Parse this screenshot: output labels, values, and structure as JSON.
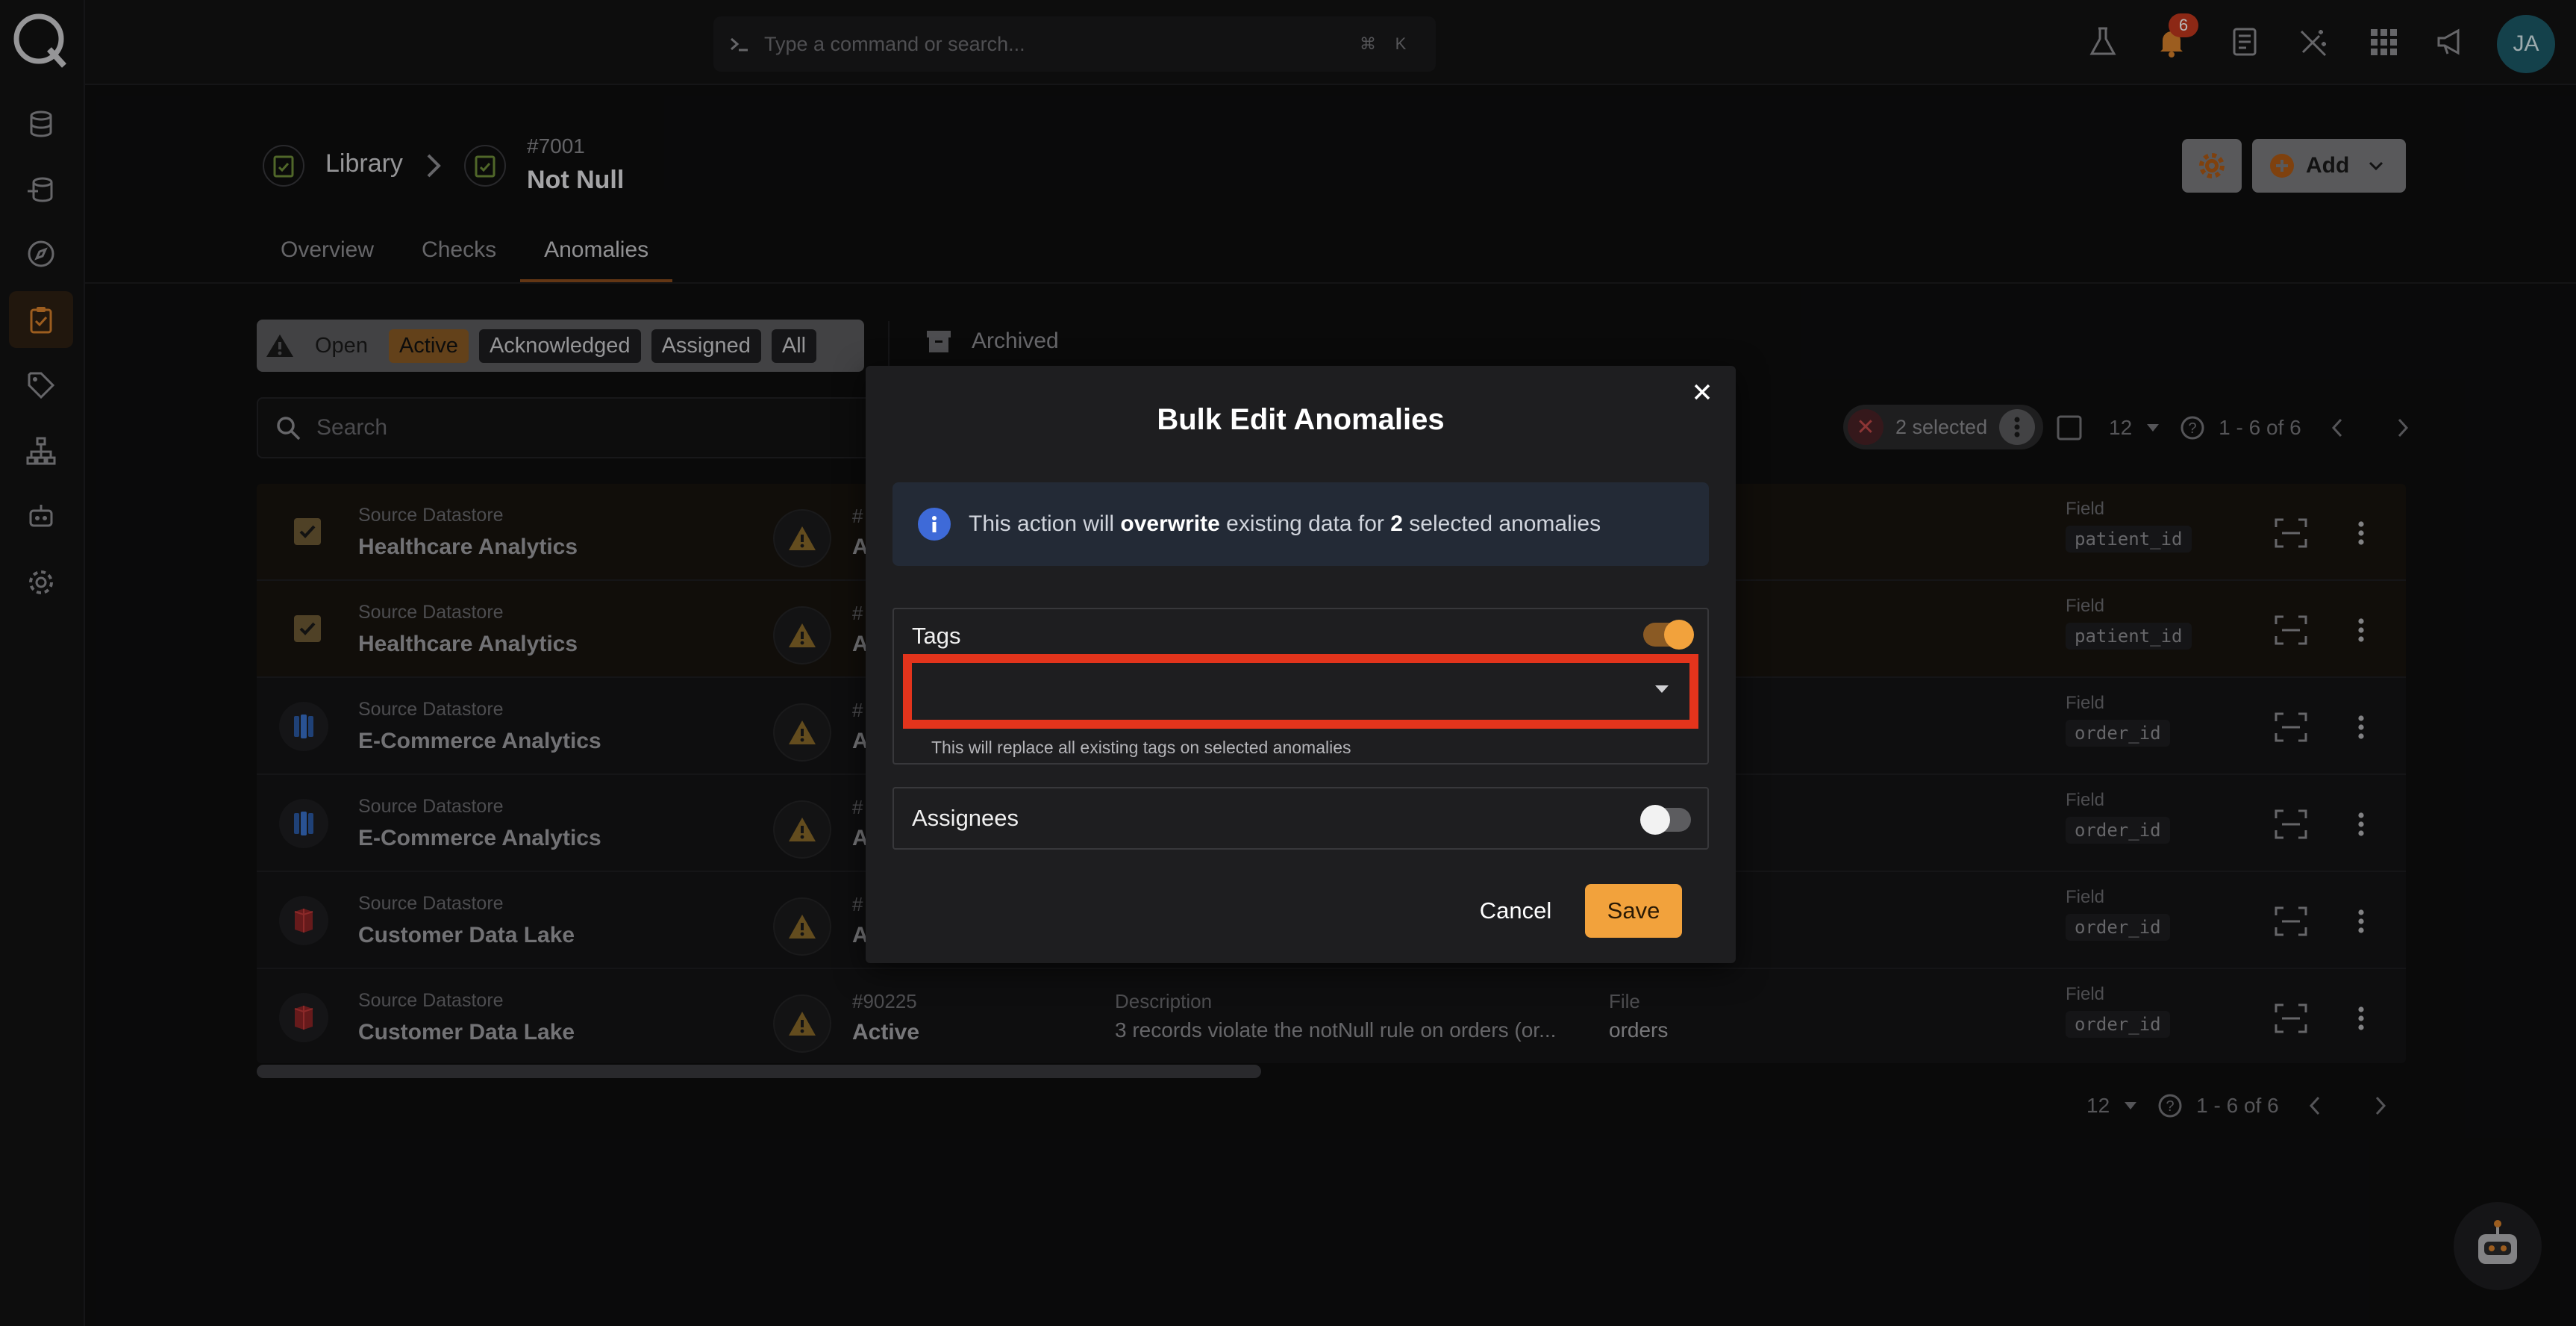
{
  "command_bar": {
    "placeholder": "Type a command or search...",
    "shortcut_mod": "⌘",
    "shortcut_key": "K"
  },
  "topbar": {
    "notification_count": "6",
    "avatar_initials": "JA"
  },
  "breadcrumb": {
    "library": "Library",
    "check_id": "#7001",
    "check_name": "Not Null"
  },
  "header": {
    "add_label": "Add"
  },
  "tabs": [
    "Overview",
    "Checks",
    "Anomalies"
  ],
  "filters": {
    "open": "Open",
    "active": "Active",
    "acknowledged": "Acknowledged",
    "assigned": "Assigned",
    "all": "All",
    "archived": "Archived"
  },
  "search": {
    "placeholder": "Search"
  },
  "selection": {
    "label": "2 selected",
    "page_size": "12",
    "range": "1 - 6 of 6"
  },
  "table": {
    "rows": [
      {
        "source_label": "Source Datastore",
        "source": "Healthcare Analytics",
        "id": "#",
        "status": "Ac",
        "desc_label": "",
        "desc": "",
        "file_label": "",
        "file": "",
        "field_label": "Field",
        "field": "patient_id"
      },
      {
        "source_label": "Source Datastore",
        "source": "Healthcare Analytics",
        "id": "#",
        "status": "Ac",
        "desc_label": "",
        "desc": "",
        "file_label": "",
        "file": "",
        "field_label": "Field",
        "field": "patient_id"
      },
      {
        "source_label": "Source Datastore",
        "source": "E-Commerce Analytics",
        "id": "#",
        "status": "Ac",
        "desc_label": "",
        "desc": "",
        "file_label": "",
        "file": "",
        "field_label": "Field",
        "field": "order_id"
      },
      {
        "source_label": "Source Datastore",
        "source": "E-Commerce Analytics",
        "id": "#",
        "status": "Ac",
        "desc_label": "",
        "desc": "",
        "file_label": "",
        "file": "",
        "field_label": "Field",
        "field": "order_id"
      },
      {
        "source_label": "Source Datastore",
        "source": "Customer Data Lake",
        "id": "#",
        "status": "Ac",
        "desc_label": "",
        "desc": "",
        "file_label": "",
        "file": "",
        "field_label": "Field",
        "field": "order_id"
      },
      {
        "source_label": "Source Datastore",
        "source": "Customer Data Lake",
        "id": "#90225",
        "status": "Active",
        "desc_label": "Description",
        "desc": "3 records violate the notNull rule on orders (or...",
        "file_label": "File",
        "file": "orders",
        "field_label": "Field",
        "field": "order_id"
      }
    ]
  },
  "footer_pager": {
    "page_size": "12",
    "range": "1 - 6 of 6"
  },
  "dialog": {
    "title": "Bulk Edit Anomalies",
    "info_pre": "This action will ",
    "info_bold1": "overwrite",
    "info_mid": " existing data for ",
    "info_bold2": "2",
    "info_post": " selected anomalies",
    "tags_label": "Tags",
    "tags_enabled": true,
    "tags_help": "This will replace all existing tags on selected anomalies",
    "assignees_label": "Assignees",
    "assignees_enabled": false,
    "cancel_label": "Cancel",
    "save_label": "Save"
  },
  "colors": {
    "accent": "#f2a23c",
    "highlight_border": "#e3341c",
    "info_icon": "#3e6ad8"
  }
}
